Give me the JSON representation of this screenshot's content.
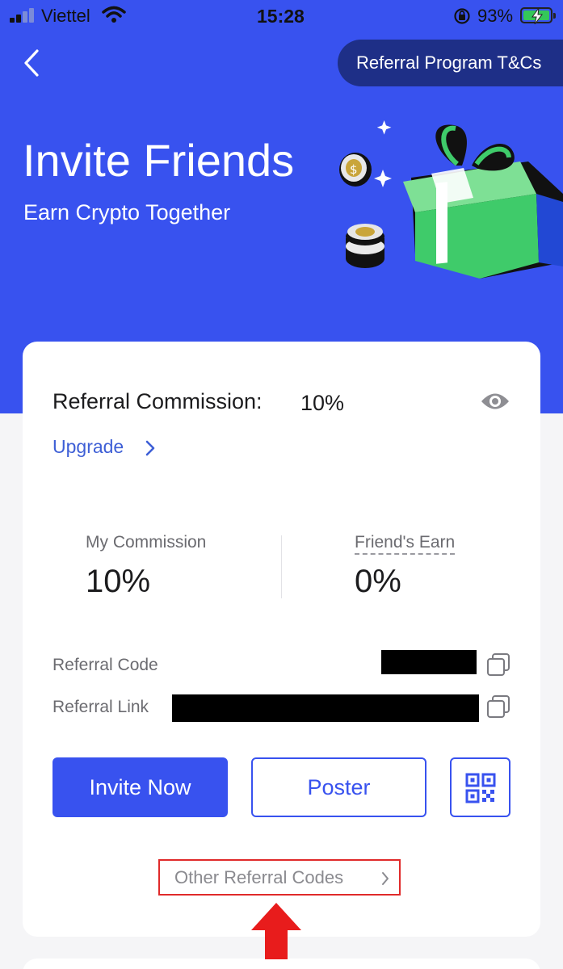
{
  "status_bar": {
    "carrier": "Viettel",
    "time": "15:28",
    "battery_percent": "93%",
    "battery_level": 0.93,
    "icons": [
      "signal-icon",
      "wifi-icon",
      "rotation-lock-icon",
      "battery-charging-icon"
    ]
  },
  "header": {
    "back_icon": "chevron-left-icon",
    "tcs_label": "Referral Program T&Cs",
    "title": "Invite Friends",
    "subtitle": "Earn Crypto Together",
    "illustration": "gift-box-with-coins"
  },
  "referral": {
    "commission_label": "Referral Commission:",
    "commission_value": "10%",
    "eye_icon": "eye-icon",
    "upgrade_label": "Upgrade",
    "my_commission_label": "My Commission",
    "my_commission_value": "10%",
    "friends_earn_label": "Friend's Earn",
    "friends_earn_value": "0%",
    "code_label": "Referral Code",
    "link_label": "Referral Link",
    "copy_icon": "copy-icon"
  },
  "actions": {
    "invite_label": "Invite Now",
    "poster_label": "Poster",
    "qr_icon": "qr-code-icon",
    "other_codes_label": "Other Referral Codes"
  },
  "colors": {
    "brand_blue": "#3852ef",
    "dark_blue": "#1e2f87",
    "highlight_red": "#e02a2a",
    "link_blue": "#3e5fd6"
  }
}
